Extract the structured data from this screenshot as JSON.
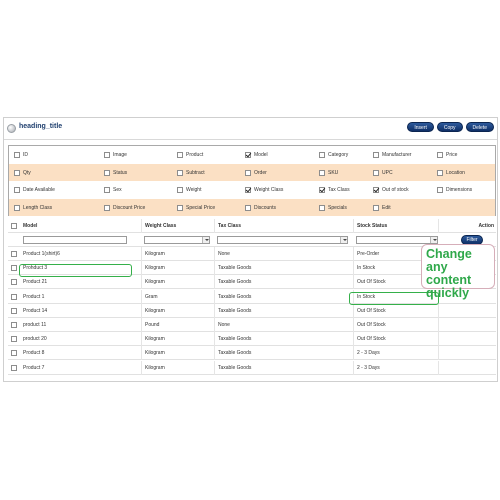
{
  "header": {
    "title": "heading_title",
    "buttons": {
      "insert": "Insert",
      "copy": "Copy",
      "delete": "Delete"
    }
  },
  "columns_panel": {
    "rows": [
      [
        {
          "label": "ID",
          "checked": false
        },
        {
          "label": "Image",
          "checked": false
        },
        {
          "label": "Product",
          "checked": false
        },
        {
          "label": "Model",
          "checked": true
        },
        {
          "label": "Category",
          "checked": false
        },
        {
          "label": "Manufacturer",
          "checked": false
        },
        {
          "label": "Price",
          "checked": false
        }
      ],
      [
        {
          "label": "Qty",
          "checked": false
        },
        {
          "label": "Status",
          "checked": false
        },
        {
          "label": "Subtract",
          "checked": false
        },
        {
          "label": "Order",
          "checked": false
        },
        {
          "label": "SKU",
          "checked": false
        },
        {
          "label": "UPC",
          "checked": false
        },
        {
          "label": "Location",
          "checked": false
        }
      ],
      [
        {
          "label": "Date Available",
          "checked": false
        },
        {
          "label": "Sex",
          "checked": false
        },
        {
          "label": "Weight",
          "checked": false
        },
        {
          "label": "Weight Class",
          "checked": true
        },
        {
          "label": "Tax Class",
          "checked": true
        },
        {
          "label": "Out of stock",
          "checked": true
        },
        {
          "label": "Dimensions",
          "checked": false
        }
      ],
      [
        {
          "label": "Length Class",
          "checked": false
        },
        {
          "label": "Discount Price",
          "checked": false
        },
        {
          "label": "Special Price",
          "checked": false
        },
        {
          "label": "Discounts",
          "checked": false
        },
        {
          "label": "Specials",
          "checked": false
        },
        {
          "label": "Edit",
          "checked": false
        }
      ]
    ]
  },
  "table": {
    "headers": {
      "model": "Model",
      "weight_class": "Weight Class",
      "tax_class": "Tax Class",
      "stock_status": "Stock Status",
      "action": "Action"
    },
    "filter": {
      "model_value": "",
      "button": "Filter"
    },
    "rows": [
      {
        "model": "Product 1(shirt)6",
        "weight_class": "Kilogram",
        "tax_class": "None",
        "stock_status": "Pre-Order"
      },
      {
        "model": "Prohduct 3",
        "weight_class": "Kilogram",
        "tax_class": "Taxable Goods",
        "stock_status": "In Stock"
      },
      {
        "model": "Product 21",
        "weight_class": "Kilogram",
        "tax_class": "Taxable Goods",
        "stock_status": "Out Of Stock"
      },
      {
        "model": "Product 1",
        "weight_class": "Gram",
        "tax_class": "Taxable Goods",
        "stock_status": "In Stock"
      },
      {
        "model": "Product 14",
        "weight_class": "Kilogram",
        "tax_class": "Taxable Goods",
        "stock_status": "Out Of Stock"
      },
      {
        "model": "product 11",
        "weight_class": "Pound",
        "tax_class": "None",
        "stock_status": "Out Of Stock"
      },
      {
        "model": "product 20",
        "weight_class": "Kilogram",
        "tax_class": "Taxable Goods",
        "stock_status": "Out Of Stock"
      },
      {
        "model": "Product 8",
        "weight_class": "Kilogram",
        "tax_class": "Taxable Goods",
        "stock_status": "2 - 3 Days"
      },
      {
        "model": "Product 7",
        "weight_class": "Kilogram",
        "tax_class": "Taxable Goods",
        "stock_status": "2 - 3 Days"
      }
    ]
  },
  "annotation": {
    "text": "Change any content quickly"
  },
  "colors": {
    "accent_button": "#1c4585",
    "highlight": "#35b04a",
    "orange_row": "#fbe0c4"
  }
}
